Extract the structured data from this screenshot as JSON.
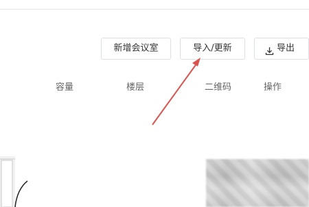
{
  "toolbar": {
    "add_label": "新增会议室",
    "import_label": "导入/更新",
    "export_label": "导出",
    "export_icon": "download-icon"
  },
  "table": {
    "columns": [
      "容量",
      "楼层",
      "二维码",
      "操作"
    ]
  },
  "annotation": {
    "arrow_color": "#d9534f"
  }
}
